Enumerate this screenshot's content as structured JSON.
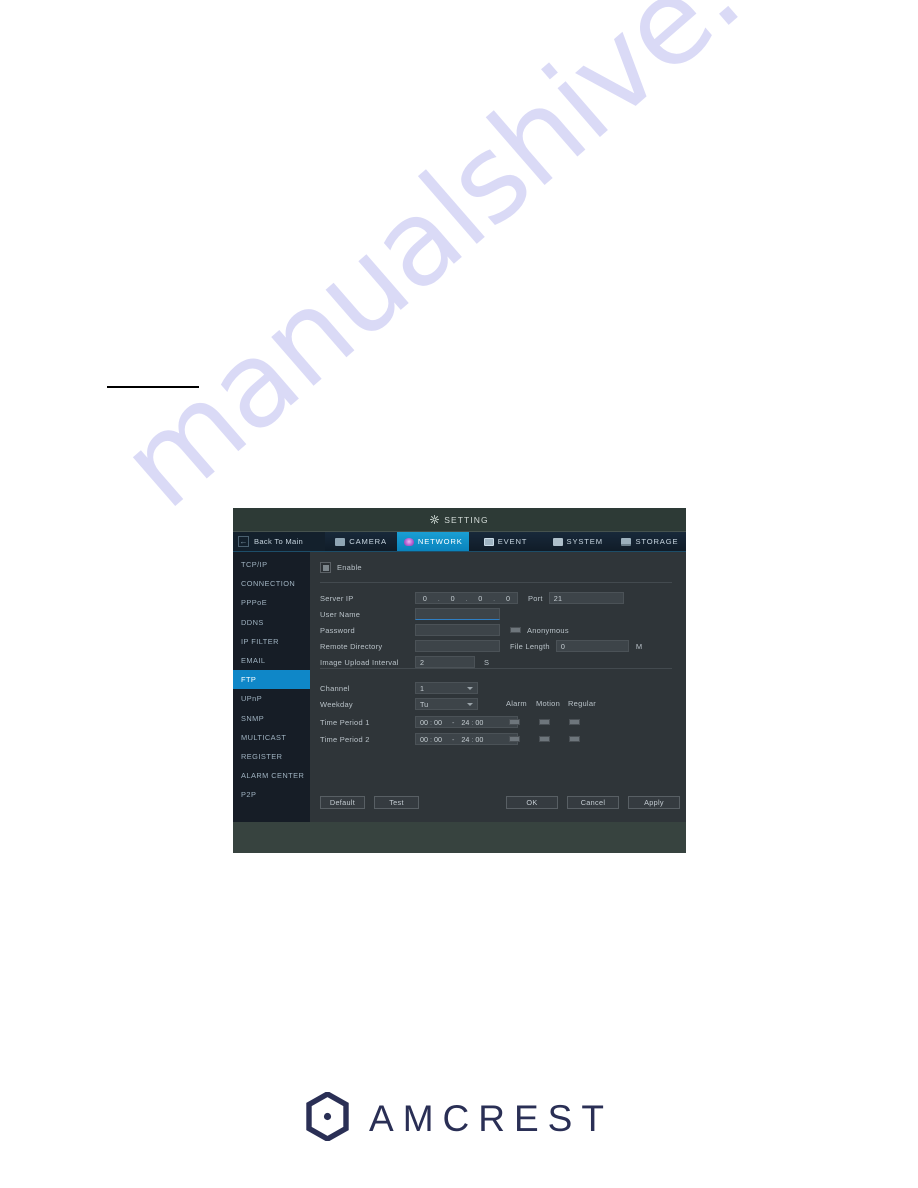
{
  "watermark": {
    "text": "manualshive.com"
  },
  "logo": {
    "text": "AMCREST",
    "mark": "hex-dot-icon"
  },
  "nvr": {
    "title": "SETTING",
    "title_icon": "gear-icon",
    "back": {
      "label": "Back To Main",
      "icon": "back-arrow-icon"
    },
    "tabs": [
      {
        "label": "CAMERA",
        "icon": "camera-icon",
        "active": false
      },
      {
        "label": "NETWORK",
        "icon": "network-icon",
        "active": true
      },
      {
        "label": "EVENT",
        "icon": "event-icon",
        "active": false
      },
      {
        "label": "SYSTEM",
        "icon": "system-icon",
        "active": false
      },
      {
        "label": "STORAGE",
        "icon": "storage-icon",
        "active": false
      }
    ],
    "sidebar": [
      {
        "label": "TCP/IP",
        "active": false
      },
      {
        "label": "CONNECTION",
        "active": false
      },
      {
        "label": "PPPoE",
        "active": false
      },
      {
        "label": "DDNS",
        "active": false
      },
      {
        "label": "IP FILTER",
        "active": false
      },
      {
        "label": "EMAIL",
        "active": false
      },
      {
        "label": "FTP",
        "active": true
      },
      {
        "label": "UPnP",
        "active": false
      },
      {
        "label": "SNMP",
        "active": false
      },
      {
        "label": "MULTICAST",
        "active": false
      },
      {
        "label": "REGISTER",
        "active": false
      },
      {
        "label": "ALARM CENTER",
        "active": false
      },
      {
        "label": "P2P",
        "active": false
      }
    ],
    "form": {
      "enable_label": "Enable",
      "enable_checked": false,
      "server_ip_label": "Server IP",
      "server_ip": {
        "o1": "0",
        "o2": "0",
        "o3": "0",
        "o4": "0"
      },
      "port_label": "Port",
      "port_value": "21",
      "user_name_label": "User Name",
      "user_name_value": "",
      "password_label": "Password",
      "password_value": "",
      "anonymous_label": "Anonymous",
      "anonymous_checked": false,
      "remote_directory_label": "Remote Directory",
      "remote_directory_value": "",
      "file_length_label": "File Length",
      "file_length_value": "0",
      "file_length_unit": "M",
      "image_upload_interval_label": "Image Upload Interval",
      "image_upload_interval_value": "2",
      "image_upload_interval_unit": "S",
      "channel_label": "Channel",
      "channel_value": "1",
      "weekday_label": "Weekday",
      "weekday_value": "Tu",
      "col_alarm": "Alarm",
      "col_motion": "Motion",
      "col_regular": "Regular",
      "period1_label": "Time Period 1",
      "period2_label": "Time Period 2",
      "period1": {
        "sh": "00",
        "sm": "00",
        "eh": "24",
        "em": "00"
      },
      "period2": {
        "sh": "00",
        "sm": "00",
        "eh": "24",
        "em": "00"
      }
    },
    "buttons": {
      "default": "Default",
      "test": "Test",
      "ok": "OK",
      "cancel": "Cancel",
      "apply": "Apply"
    },
    "colors": {
      "accent_tab": "#0a83bd",
      "accent_sidebar": "#0f87c8",
      "dialog_bg": "#37433f",
      "content_bg": "#2f3539",
      "sidebar_bg": "#161d26"
    }
  }
}
